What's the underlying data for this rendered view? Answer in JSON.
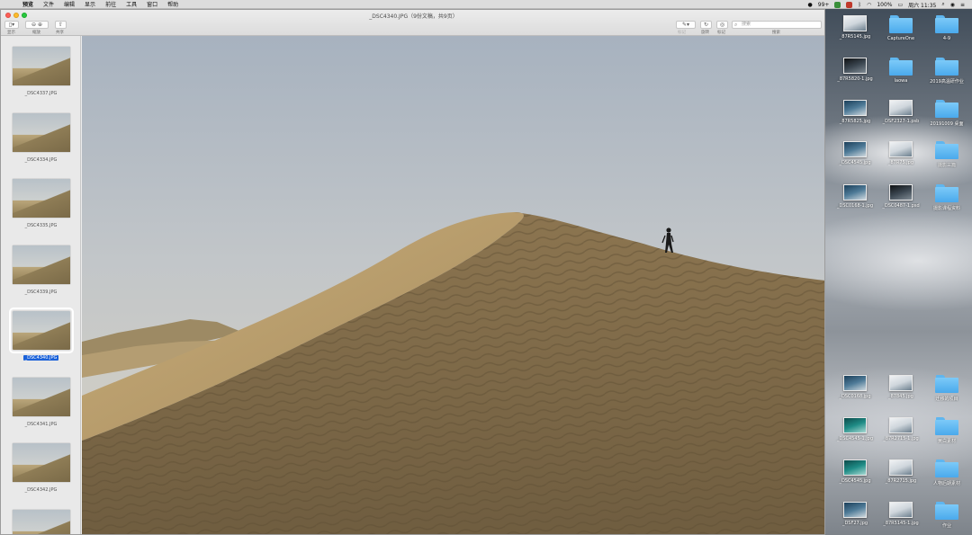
{
  "menubar": {
    "apple": "",
    "items": [
      "预览",
      "文件",
      "编辑",
      "显示",
      "前往",
      "工具",
      "窗口",
      "帮助"
    ],
    "status": {
      "notifications": "99+",
      "battery": "100%",
      "clock": "周六 11:35"
    }
  },
  "window": {
    "title": "_DSC4340.JPG（9份文稿，共9页）",
    "toolbar": {
      "sidebar_label": "显示",
      "zoom_label": "缩放",
      "share_label": "共享",
      "markup_label": "标记",
      "rotate_label": "旋转",
      "highlight_label": "标记",
      "search_label": "搜索",
      "search_placeholder": "搜索"
    }
  },
  "sidebar": {
    "thumbnails": [
      {
        "label": "_DSC4337.JPG",
        "selected": false
      },
      {
        "label": "_DSC4334.JPG",
        "selected": false
      },
      {
        "label": "_DSC4335.JPG",
        "selected": false
      },
      {
        "label": "_DSC4339.JPG",
        "selected": false
      },
      {
        "label": "_DSC4340.JPG",
        "selected": true
      },
      {
        "label": "_DSC4341.JPG",
        "selected": false
      },
      {
        "label": "_DSC4342.JPG",
        "selected": false
      },
      {
        "label": "",
        "selected": false
      }
    ]
  },
  "desktop": {
    "items": [
      {
        "label": "_87R5145.jpg",
        "type": "image",
        "style": "light"
      },
      {
        "label": "CaptureOne",
        "type": "folder"
      },
      {
        "label": "4-9",
        "type": "folder"
      },
      {
        "label": "_87R5820-1.jpg",
        "type": "image",
        "style": "dark"
      },
      {
        "label": "laowa",
        "type": "folder"
      },
      {
        "label": "2019高温研作业",
        "type": "folder"
      },
      {
        "label": "_87R5825.jpg",
        "type": "image",
        "style": "normal"
      },
      {
        "label": "_DSF2327-1.psb",
        "type": "image",
        "style": "light"
      },
      {
        "label": "20191009 桌面",
        "type": "folder"
      },
      {
        "label": "_DSC4545.jpg",
        "type": "image",
        "style": "normal"
      },
      {
        "label": "_87R75.jpg",
        "type": "image",
        "style": "light"
      },
      {
        "label": "摄影三篇",
        "type": "folder"
      },
      {
        "label": "_DSC0168-1.jpg",
        "type": "image",
        "style": "normal"
      },
      {
        "label": "_DSC0487-1.psd",
        "type": "image",
        "style": "dark"
      },
      {
        "label": "摄影课程资料",
        "type": "folder"
      },
      {
        "label": "_DSC0168.jpg",
        "type": "image",
        "style": "normal"
      },
      {
        "label": "_87845.jpg",
        "type": "image",
        "style": "light"
      },
      {
        "label": "迁移的项目",
        "type": "folder"
      },
      {
        "label": "_DSC4545-1.jpg",
        "type": "image",
        "style": "teal"
      },
      {
        "label": "_87R2715-1.jpg",
        "type": "image",
        "style": "light"
      },
      {
        "label": "黄白素材",
        "type": "folder"
      },
      {
        "label": "_DSC4545.jpg",
        "type": "image",
        "style": "teal"
      },
      {
        "label": "_87R2715.jpg",
        "type": "image",
        "style": "light"
      },
      {
        "label": "人物后期素材",
        "type": "folder"
      },
      {
        "label": "_DSF27.jpg",
        "type": "image",
        "style": "normal"
      },
      {
        "label": "_87R5145-1.jpg",
        "type": "image",
        "style": "light"
      },
      {
        "label": "作业",
        "type": "folder"
      }
    ]
  }
}
